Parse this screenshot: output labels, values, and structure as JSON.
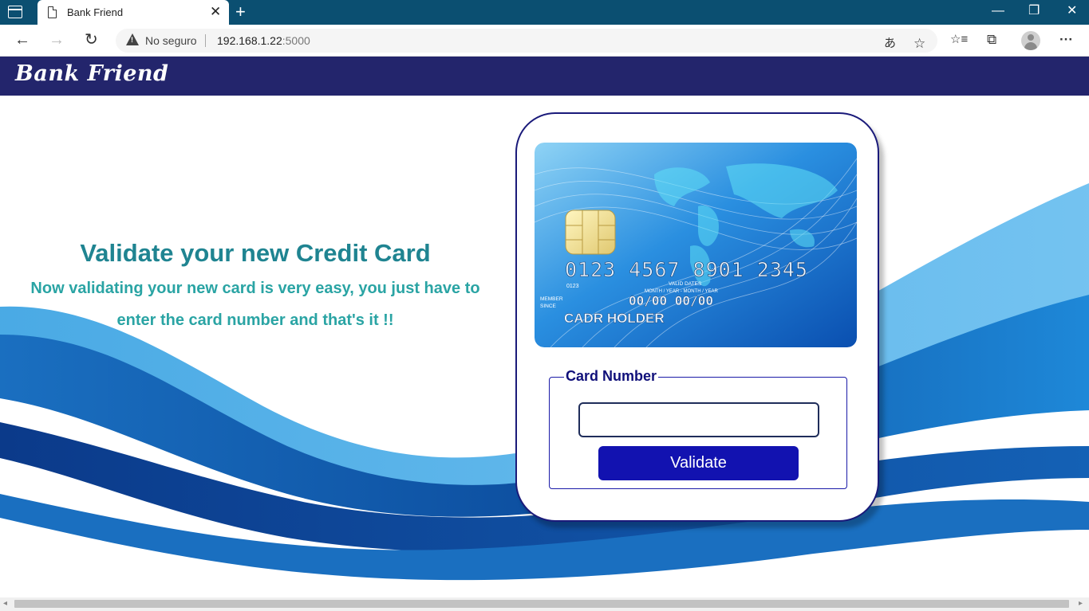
{
  "browser": {
    "tab_title": "Bank Friend",
    "tab_close": "✕",
    "new_tab": "+",
    "security_label": "No seguro",
    "url_host": "192.168.1.22",
    "url_port": ":5000",
    "window_controls": {
      "minimize": "—",
      "restore": "❐",
      "close": "✕"
    },
    "nav": {
      "back": "←",
      "forward": "→",
      "reload": "↻"
    },
    "toolbar": {
      "translate": "あ",
      "favorite": "☆",
      "favorites": "☆≡",
      "collections": "⧉",
      "more": "···"
    }
  },
  "site": {
    "brand": "Bank Friend"
  },
  "hero": {
    "title": "Validate your new Credit Card",
    "subtitle": "Now validating your new card is very easy, you just have to enter the card number and that's it !!"
  },
  "card": {
    "number": "0123 4567 8901 2345",
    "small_number": "0123",
    "member_since_line1": "MEMBER",
    "member_since_line2": "SINCE",
    "valid_dates": "VALID DATES",
    "valid_sub": "MONTH / YEAR - MONTH / YEAR",
    "dates": "00/00  00/00",
    "holder": "CADR HOLDER"
  },
  "form": {
    "legend": "Card Number",
    "input_value": "",
    "button_label": "Validate"
  },
  "colors": {
    "tabbar": "#0b4f71",
    "header": "#23256c",
    "title": "#1f8491",
    "subtitle": "#2aa4a4",
    "button": "#1212b0"
  }
}
